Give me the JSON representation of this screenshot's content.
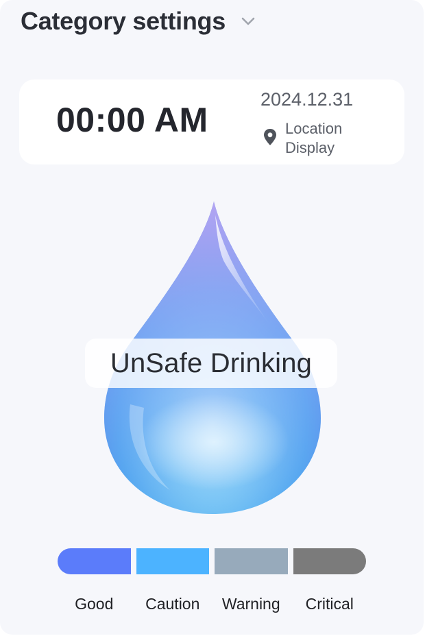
{
  "header": {
    "title": "Category settings",
    "dropdown_icon": "chevron-down-icon"
  },
  "time_card": {
    "time": "00:00 AM",
    "date": "2024.12.31",
    "location_icon": "map-pin-icon",
    "location_line1": "Location",
    "location_line2": "Display"
  },
  "status": {
    "label": "UnSafe Drinking",
    "illustration": "water-drop-illustration"
  },
  "scale": {
    "levels": [
      {
        "label": "Good",
        "color": "#5b7cfa"
      },
      {
        "label": "Caution",
        "color": "#4cb3ff"
      },
      {
        "label": "Warning",
        "color": "#97aabb"
      },
      {
        "label": "Critical",
        "color": "#7b7b7b"
      }
    ]
  }
}
